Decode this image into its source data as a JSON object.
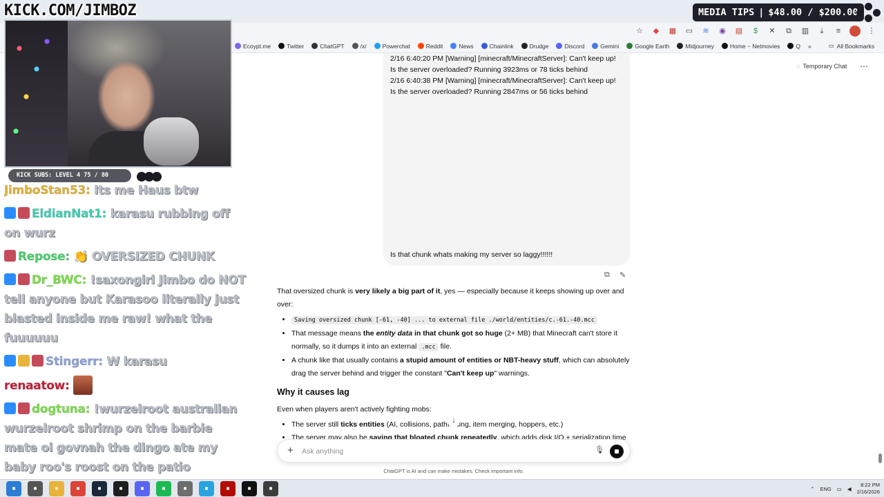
{
  "overlay": {
    "brand": "KICK.COM/JIMBOZ",
    "media_tips": {
      "label": "MEDIA TIPS",
      "current": "$48.00",
      "goal": "$200.00"
    },
    "kick_sub_bar": "KICK SUBS: LEVEL 4 75 / 80"
  },
  "browser": {
    "bookmarks": [
      {
        "label": "Ecoypt.me",
        "icon": "site-icon",
        "color": "#7b68ee"
      },
      {
        "label": "Twitter",
        "icon": "x-icon",
        "color": "#111111"
      },
      {
        "label": "ChatGPT",
        "icon": "openai-icon",
        "color": "#333333"
      },
      {
        "label": "/x/",
        "icon": "board-icon",
        "color": "#555555"
      },
      {
        "label": "Powerchat",
        "icon": "powerchat-icon",
        "color": "#1da1f2"
      },
      {
        "label": "Reddit",
        "icon": "reddit-icon",
        "color": "#ff4500"
      },
      {
        "label": "News",
        "icon": "news-icon",
        "color": "#4285f4"
      },
      {
        "label": "Chainlink",
        "icon": "chainlink-icon",
        "color": "#375bd2"
      },
      {
        "label": "Drudge",
        "icon": "drudge-icon",
        "color": "#222222"
      },
      {
        "label": "Discord",
        "icon": "discord-icon",
        "color": "#5865f2"
      },
      {
        "label": "Gemini",
        "icon": "gemini-icon",
        "color": "#4a7be0"
      },
      {
        "label": "Google Earth",
        "icon": "earth-icon",
        "color": "#2e7d32"
      },
      {
        "label": "Midjourney",
        "icon": "midjourney-icon",
        "color": "#222222"
      },
      {
        "label": "Home ~ Netmovies",
        "icon": "play-icon",
        "color": "#111111"
      },
      {
        "label": "Q",
        "icon": "q-icon",
        "color": "#111111"
      }
    ],
    "all_bookmarks": "All Bookmarks"
  },
  "chat": [
    {
      "user": "JimboStan53:",
      "color": "#e3b33a",
      "text": "Its me Haus btw",
      "badges": []
    },
    {
      "user": "EldianNat1:",
      "color": "#3fd1b4",
      "text": "karasu rubbing off on wurz",
      "badges": [
        "#2b8cff",
        "#c44b5a"
      ]
    },
    {
      "user": "Repose:",
      "color": "#4cd06d",
      "text": "👏 OVERSIZED CHUNK",
      "badges": [
        "#c44b5a"
      ]
    },
    {
      "user": "Dr_BWC:",
      "color": "#7be04a",
      "text": "!saxongirl Jimbo do NOT tell anyone but Karasoo literally just blasted inside me raw! what the fuuuuuu",
      "badges": [
        "#2b8cff",
        "#c44b5a"
      ]
    },
    {
      "user": "Stingerr:",
      "color": "#8fa3d9",
      "text": "W karasu",
      "badges": [
        "#2b8cff",
        "#e8b43a",
        "#c44b5a"
      ]
    },
    {
      "user": "renaatow:",
      "color": "#c4233a",
      "text": "",
      "badges": [],
      "emote": true
    },
    {
      "user": "dogtuna:",
      "color": "#7be04a",
      "text": "!wurzelroot australian wurzelroot shrimp on the barbie mate oi govnah the dingo ate my baby roo's roost on the patio",
      "badges": [
        "#2b8cff",
        "#c44b5a"
      ]
    }
  ],
  "chatgpt": {
    "temporary_chat": "Temporary Chat",
    "user_message": {
      "log_lines": [
        "2/16 6:40:20 PM [Warning] [minecraft/MinecraftServer]: Can't keep up!",
        "Is the server overloaded? Running 3923ms or 78 ticks behind",
        "2/16 6:40:38 PM [Warning] [minecraft/MinecraftServer]: Can't keep up!",
        "Is the server overloaded? Running 2847ms or 56 ticks behind"
      ],
      "question": "Is that chunk whats making my server so laggy!!!!!!"
    },
    "answer": {
      "intro_a": "That oversized chunk is ",
      "intro_bold": "very likely a big part of it",
      "intro_b": ", yes — especially because it keeps showing up over and over:",
      "code_line": "Saving oversized chunk [-61, -40] ... to external file ./world/entities/c.-61.-40.mcc",
      "b2_a": "That message means ",
      "b2_bold1": "the ",
      "b2_italic": "entity data",
      "b2_bold2": " in that chunk got so huge",
      "b2_b": " (2+ MB) that Minecraft can't store it normally, so it dumps it into an external ",
      "b2_code": ".mcc",
      "b2_c": " file.",
      "b3_a": "A chunk like that usually contains ",
      "b3_bold": "a stupid amount of entities or NBT-heavy stuff",
      "b3_b": ", which can absolutely drag the server behind and trigger the constant \"",
      "b3_bold2": "Can't keep up",
      "b3_c": "\" warnings.",
      "heading": "Why it causes lag",
      "p2": "Even when players aren't actively fighting mobs:",
      "b4_a": "The server still ",
      "b4_bold": "ticks entities",
      "b4_b": " (AI, collisions, pathfinding, item merging, hoppers, etc.)",
      "b5_a": "The server may also be ",
      "b5_bold": "saving that bloated chunk repeatedly",
      "b5_b": ", which adds disk I/O + serialization time"
    },
    "composer_placeholder": "Ask anything",
    "disclaimer": "ChatGPT is AI and can make mistakes. Check important info."
  },
  "taskbar": {
    "apps": [
      {
        "icon": "windows-icon",
        "color": "#2b7cd3"
      },
      {
        "icon": "task-view-icon",
        "color": "#555555"
      },
      {
        "icon": "file-explorer-icon",
        "color": "#e8b33a"
      },
      {
        "icon": "chrome-icon",
        "color": "#db4437"
      },
      {
        "icon": "steam-icon",
        "color": "#1b2838"
      },
      {
        "icon": "terminal-icon",
        "color": "#1e1e1e"
      },
      {
        "icon": "discord-icon",
        "color": "#5865f2"
      },
      {
        "icon": "spotify-icon",
        "color": "#1db954"
      },
      {
        "icon": "game-icon",
        "color": "#6d6d6d"
      },
      {
        "icon": "telegram-icon",
        "color": "#2aa3df"
      },
      {
        "icon": "adobe-icon",
        "color": "#b30b00"
      },
      {
        "icon": "cursor-app-icon",
        "color": "#111111"
      },
      {
        "icon": "minecraft-icon",
        "color": "#3c3c3c"
      }
    ],
    "language": "ENG",
    "time": "8:22 PM",
    "date": "2/16/2026"
  }
}
